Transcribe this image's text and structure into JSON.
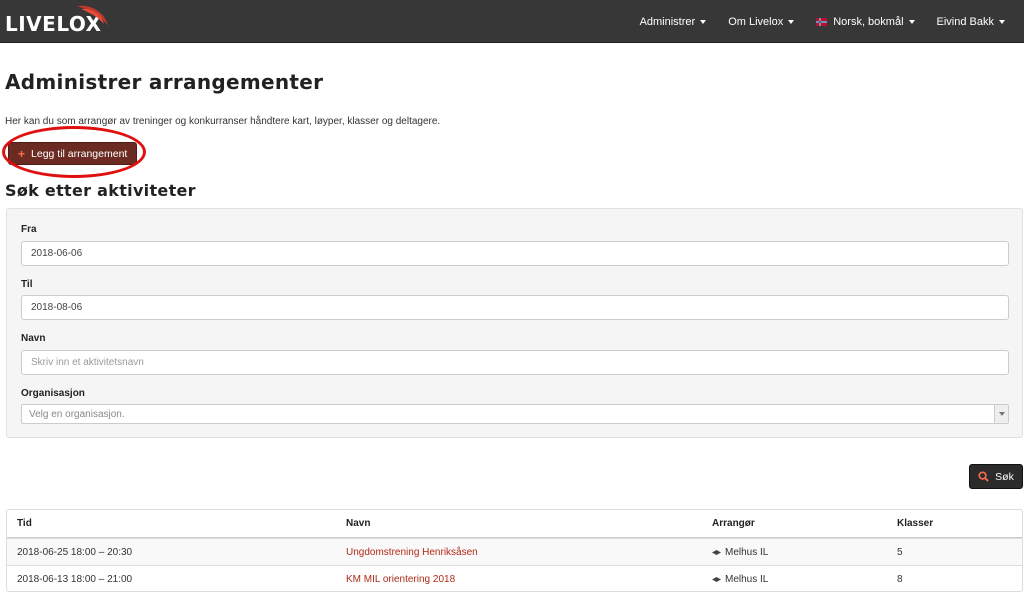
{
  "navbar": {
    "brand": "LIVELOX",
    "items": [
      {
        "label": "Administrer"
      },
      {
        "label": "Om Livelox"
      },
      {
        "label": "Norsk, bokmål"
      },
      {
        "label": "Eivind Bakk"
      }
    ]
  },
  "page": {
    "title": "Administrer arrangementer",
    "intro": "Her kan du som arrangør av treninger og konkurranser håndtere kart, løyper, klasser og deltagere.",
    "add_button": "Legg til arrangement",
    "search_title": "Søk etter aktiviteter"
  },
  "search": {
    "from_label": "Fra",
    "from_value": "2018-06-06",
    "to_label": "Til",
    "to_value": "2018-08-06",
    "name_label": "Navn",
    "name_placeholder": "Skriv inn et aktivitetsnavn",
    "org_label": "Organisasjon",
    "org_placeholder": "Velg en organisasjon.",
    "button": "Søk"
  },
  "results": {
    "columns": [
      "Tid",
      "Navn",
      "Arrangør",
      "Klasser"
    ],
    "rows": [
      {
        "time": "2018-06-25 18:00 – 20:30",
        "name": "Ungdomstrening Henriksåsen",
        "organizer": "Melhus IL",
        "classes": "5"
      },
      {
        "time": "2018-06-13 18:00 – 21:00",
        "name": "KM MIL orientering 2018",
        "organizer": "Melhus IL",
        "classes": "8"
      }
    ]
  },
  "colors": {
    "navbar_bg": "#373737",
    "accent_button": "#6b2b23",
    "link": "#b02a16",
    "highlight": "#e01010"
  },
  "icons": {
    "flag": "norway-flag-icon",
    "add": "plus-icon",
    "search": "magnifier-icon",
    "organizer": "club-logo-icon"
  }
}
